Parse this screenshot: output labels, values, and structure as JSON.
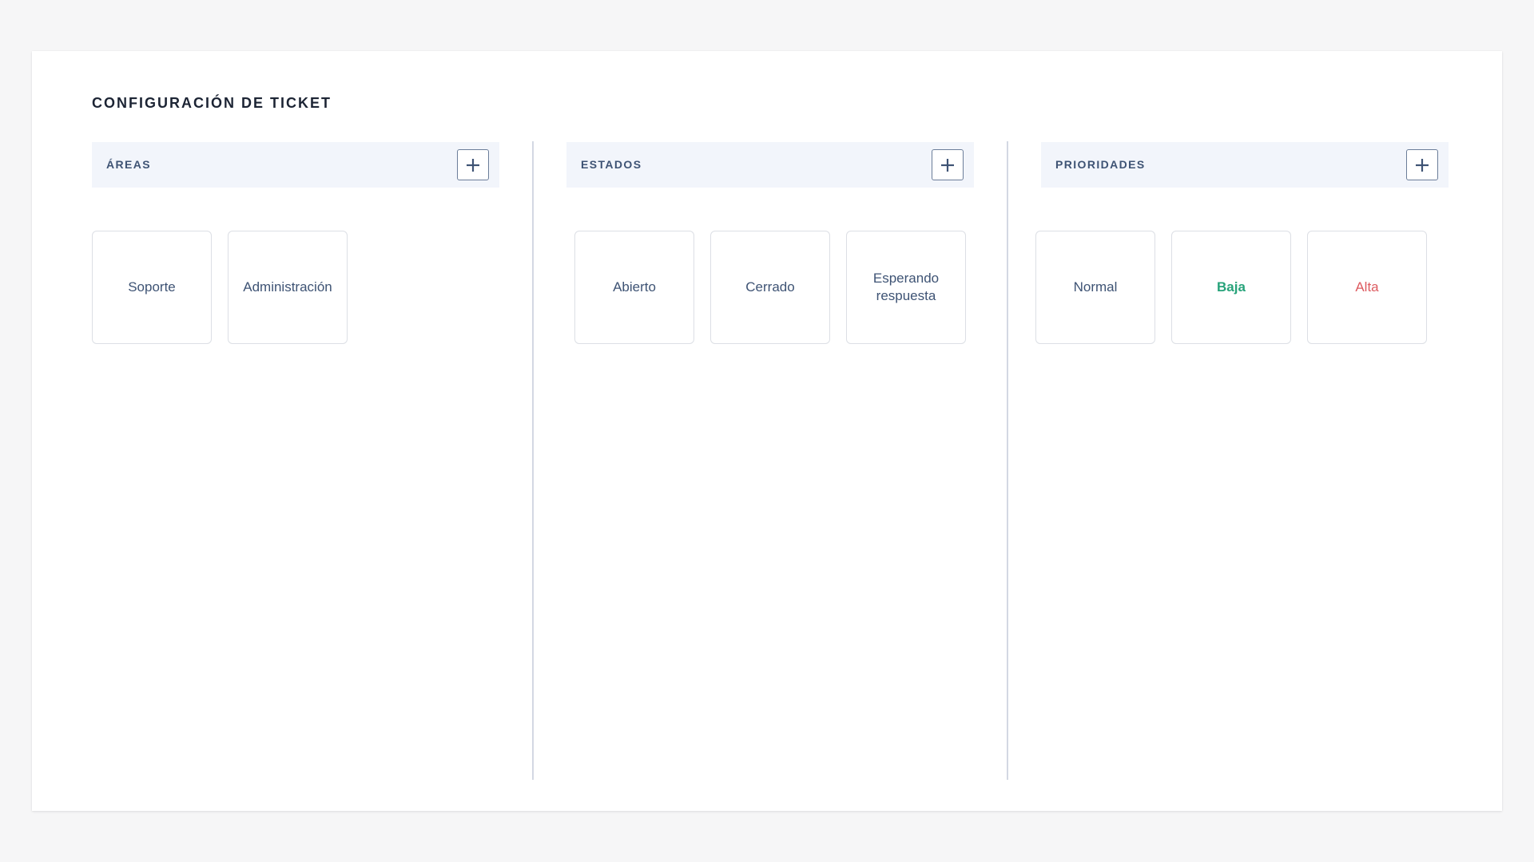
{
  "page": {
    "title": "CONFIGURACIÓN DE TICKET"
  },
  "columns": [
    {
      "title": "ÁREAS",
      "add_icon": "plus-icon",
      "items": [
        {
          "label": "Soporte"
        },
        {
          "label": "Administración"
        }
      ]
    },
    {
      "title": "ESTADOS",
      "add_icon": "plus-icon",
      "items": [
        {
          "label": "Abierto"
        },
        {
          "label": "Cerrado"
        },
        {
          "label": "Esperando respuesta"
        }
      ]
    },
    {
      "title": "PRIORIDADES",
      "add_icon": "plus-icon",
      "items": [
        {
          "label": "Normal",
          "color": "#3e5374"
        },
        {
          "label": "Baja",
          "color": "#27a37a"
        },
        {
          "label": "Alta",
          "color": "#dd5b60"
        }
      ]
    }
  ],
  "colors": {
    "background": "#f6f6f7",
    "card": "#ffffff",
    "header_bg": "#f2f5fb",
    "text": "#3e5374",
    "title": "#1c2434",
    "divider": "#d3d8e3"
  }
}
